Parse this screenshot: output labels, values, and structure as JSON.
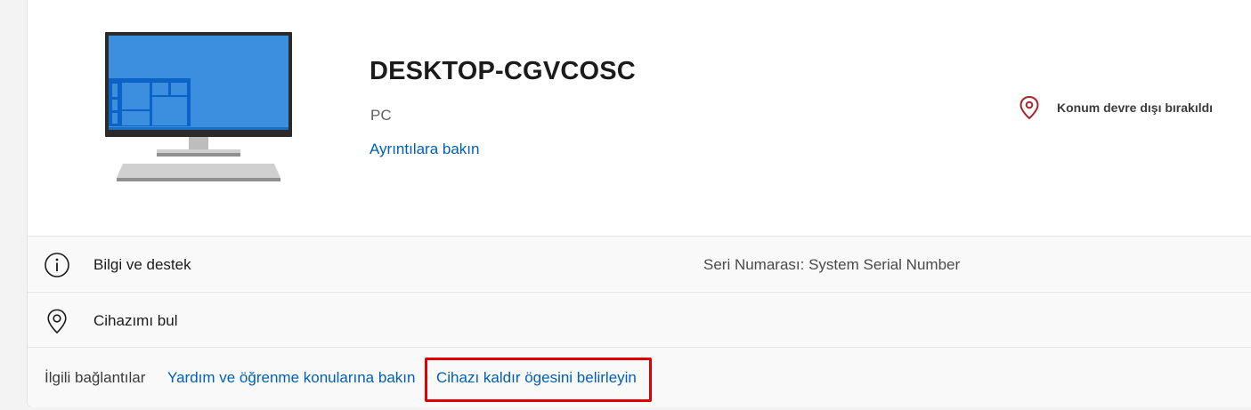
{
  "device": {
    "name": "DESKTOP-CGVCOSC",
    "type": "PC",
    "details_link": "Ayrıntılara bakın",
    "image": "desktop-monitor-illustration"
  },
  "location": {
    "status": "Konum devre dışı bırakıldı",
    "icon": "location-pin-icon",
    "color": "#a4262c"
  },
  "rows": {
    "info": {
      "icon": "info-icon",
      "label": "Bilgi ve destek",
      "serial": "Seri Numarası: System Serial Number"
    },
    "find": {
      "icon": "location-pin-icon",
      "label": "Cihazımı bul"
    }
  },
  "related": {
    "label": "İlgili bağlantılar",
    "help_link": "Yardım ve öğrenme konularına bakın",
    "remove_link": "Cihazı kaldır ögesini belirleyin"
  },
  "colors": {
    "accent_link": "#005fb8",
    "highlight": "#e00000",
    "screen_blue": "#3b8fde"
  }
}
